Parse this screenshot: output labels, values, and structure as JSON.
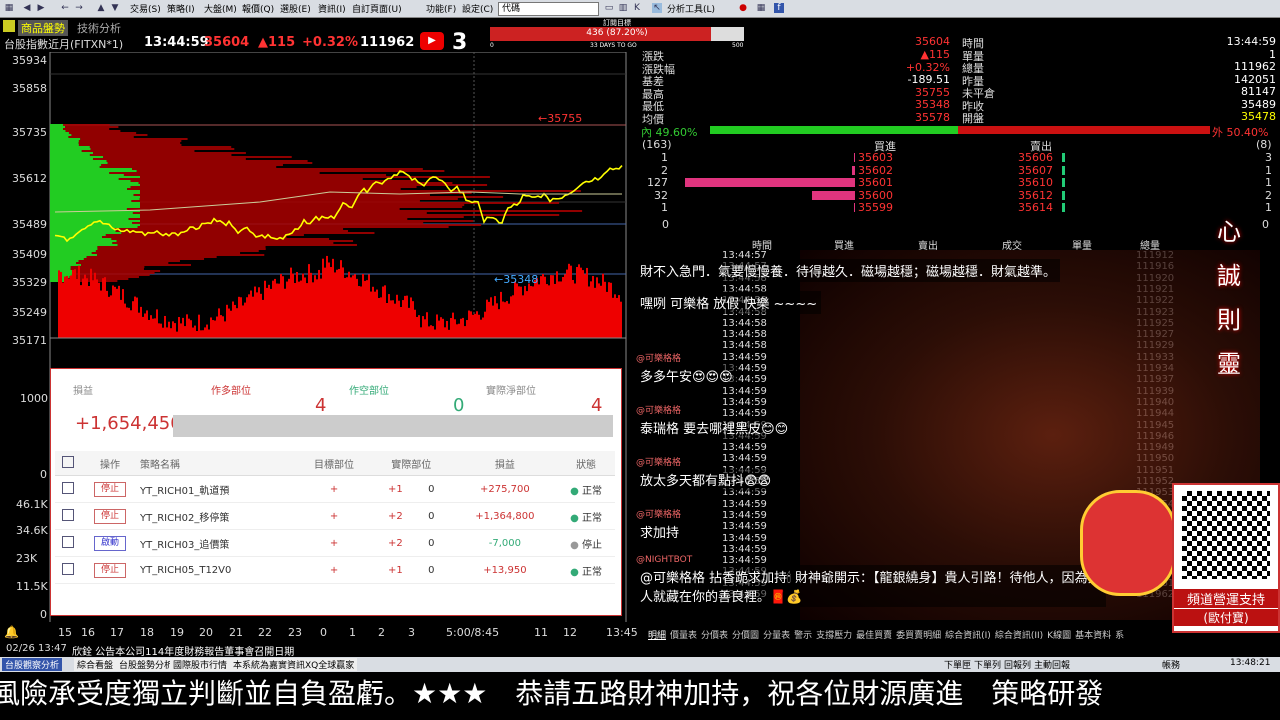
{
  "toolbar": {
    "menus": [
      "交易(S)",
      "策略(I)",
      "大盤(M)",
      "報價(Q)",
      "選股(E)",
      "資訊(I)",
      "自訂頁面(U)",
      "功能(F)",
      "設定(C)",
      "代碼"
    ],
    "analysis_tool": "分析工具(L)"
  },
  "chart_header": {
    "tab_active": "商品盤勢",
    "tab_other": "技術分析",
    "symbol": "台股指數近月(FITXN*1)",
    "time": "13:44:59",
    "price": "35604",
    "change": "▲115",
    "change_pct": "+0.32%",
    "volume": "111962",
    "badge": "3"
  },
  "order_bar": {
    "title": "訂閱目標",
    "progress_text": "436 (87.20%)",
    "progress": 0.872,
    "left_label": "0",
    "mid_label": "33 DAYS TO GO",
    "right_label": "500"
  },
  "price_axis": [
    "35934",
    "35858",
    "35735",
    "35612",
    "35489",
    "35409",
    "35329",
    "35249",
    "35171"
  ],
  "vol_axis": [
    "1000",
    "0",
    "46.1K",
    "34.6K",
    "23K",
    "11.5K",
    "0"
  ],
  "annotations": {
    "high": "35755",
    "low": "35348"
  },
  "x_axis": [
    "15",
    "16",
    "17",
    "18",
    "19",
    "20",
    "21",
    "22",
    "23",
    "0",
    "1",
    "2",
    "3",
    "5:00/8:45",
    "11",
    "12",
    "13:45"
  ],
  "strategy": {
    "pnl_label": "損益",
    "pnl_value": "+1,654,450",
    "long_label": "作多部位",
    "long_value": "4",
    "short_label": "作空部位",
    "short_value": "0",
    "net_label": "實際淨部位",
    "net_value": "4",
    "headers": [
      "操作",
      "策略名稱",
      "目標部位",
      "實際部位",
      "損益",
      "狀態"
    ],
    "rows": [
      {
        "action": "停止",
        "name": "YT_RICH01_軌道預",
        "target": "+",
        "actual": "+1",
        "zero": "0",
        "pnl": "+275,700",
        "status": "正常"
      },
      {
        "action": "停止",
        "name": "YT_RICH02_移停策",
        "target": "+",
        "actual": "+2",
        "zero": "0",
        "pnl": "+1,364,800",
        "status": "正常"
      },
      {
        "action": "啟動",
        "name": "YT_RICH03_追價策",
        "target": "+",
        "actual": "+2",
        "zero": "0",
        "pnl": "-7,000",
        "status": "停止"
      },
      {
        "action": "停止",
        "name": "YT_RICH05_T12V0",
        "target": "+",
        "actual": "+1",
        "zero": "0",
        "pnl": "+13,950",
        "status": "正常"
      }
    ]
  },
  "quote": {
    "labels": [
      "漲跌",
      "漲跌幅",
      "基差",
      "最高",
      "最低",
      "均價"
    ],
    "values": [
      "▲115",
      "+0.32%",
      "-189.51",
      "35755",
      "35348",
      "35578"
    ],
    "price": "35604",
    "labels_r": [
      "時間",
      "單量",
      "總量",
      "昨量",
      "未平倉",
      "昨收",
      "開盤"
    ],
    "values_r": [
      "13:44:59",
      "1",
      "111962",
      "142051",
      "81147",
      "35489",
      "35478"
    ],
    "inner_label": "內",
    "inner_pct": "49.60%",
    "outer_pct": "50.40%",
    "outer_label": "外"
  },
  "depth": {
    "bid_count": "(163)",
    "ask_count": "(8)",
    "bid_title": "買進",
    "ask_title": "賣出",
    "rows": [
      {
        "bid_qty": "1",
        "bid": "35603",
        "ask": "35606",
        "ask_qty": "3"
      },
      {
        "bid_qty": "2",
        "bid": "35602",
        "ask": "35607",
        "ask_qty": "1"
      },
      {
        "bid_qty": "127",
        "bid": "35601",
        "ask": "35610",
        "ask_qty": "1"
      },
      {
        "bid_qty": "32",
        "bid": "35600",
        "ask": "35612",
        "ask_qty": "2"
      },
      {
        "bid_qty": "1",
        "bid": "35599",
        "ask": "35614",
        "ask_qty": "1"
      }
    ],
    "bottom_left": "0",
    "bottom_right": "0"
  },
  "tick_headers": [
    "時間",
    "買進",
    "賣出",
    "成交",
    "單量",
    "總量"
  ],
  "tick_times": [
    "13:44:57",
    "13:44:57",
    "13:44:58",
    "13:44:58",
    "13:44:58",
    "13:44:58",
    "13:44:58",
    "13:44:58",
    "13:44:58",
    "13:44:59",
    "13:44:59",
    "13:44:59",
    "13:44:59",
    "13:44:59",
    "13:44:59",
    "13:44:59",
    "13:44:59",
    "13:44:59",
    "13:44:59",
    "13:44:59",
    "13:44:59",
    "13:44:59",
    "13:44:59",
    "13:44:59",
    "13:44:59",
    "13:44:59",
    "13:44:59",
    "13:44:59",
    "13:44:59",
    "13:44:59",
    "13:44:59"
  ],
  "tick_totals": [
    "111912",
    "111916",
    "111920",
    "111921",
    "111922",
    "111923",
    "111925",
    "111927",
    "111929",
    "111933",
    "111934",
    "111937",
    "111939",
    "111940",
    "111944",
    "111945",
    "111946",
    "111949",
    "111950",
    "111951",
    "111952",
    "111953",
    "111954",
    "111955",
    "111956",
    "111957",
    "111958",
    "111959",
    "111960",
    "111961",
    "111962"
  ],
  "chat": [
    {
      "name": "",
      "msg": "財不入急門．氣要慢慢養．待得越久．磁場越穩；磁場越穩．財氣越準。"
    },
    {
      "name": "",
      "msg": "嘿咧 可樂格 放假 快樂 ~~~~"
    },
    {
      "name": "@可樂格格",
      "msg": "多多午安😍😍😍"
    },
    {
      "name": "@可樂格格",
      "msg": "泰瑞格 要去哪裡黑皮😊😊"
    },
    {
      "name": "@可樂格格",
      "msg": "放太多天都有點抖😨😨"
    },
    {
      "name": "@可樂格格",
      "msg": "求加持"
    },
    {
      "name": "@NIGHTBOT",
      "msg": "@可樂格格 拈香跪求加持🕯 財神爺開示：【龍銀繞身】貴人引路！待他人，因為貴人就藏在你的善良裡。🧧💰"
    }
  ],
  "side_text": [
    "心",
    "誠",
    "則",
    "靈"
  ],
  "qr_caption": "頻道營運支持",
  "qr_sub": "(歐付寶)",
  "bottom_tabs": [
    "明細",
    "價量表",
    "分價表",
    "分價圖",
    "分量表",
    "警示",
    "支撐壓力",
    "最佳買賣",
    "委買賣明細",
    "綜合資訊(I)",
    "綜合資訊(II)",
    "K線圖",
    "基本資料",
    "系"
  ],
  "status": {
    "date": "02/26 13:47",
    "news": "欣銓 公告本公司114年度財務報告董事會召開日期"
  },
  "taskbar": [
    "台股觀察分析",
    "綜合看盤",
    "台股盤勢分析",
    "國際股市行情",
    "本系統為嘉實資訊XQ全球贏家"
  ],
  "taskbar_right": [
    "下單匣",
    "下單列",
    "回報列",
    "主動回報",
    "帳務",
    "13:48:21"
  ],
  "marquee": "風險承受度獨立判斷並自負盈虧。★★★　恭請五路財神加持，祝各位財源廣進　策略研發"
}
